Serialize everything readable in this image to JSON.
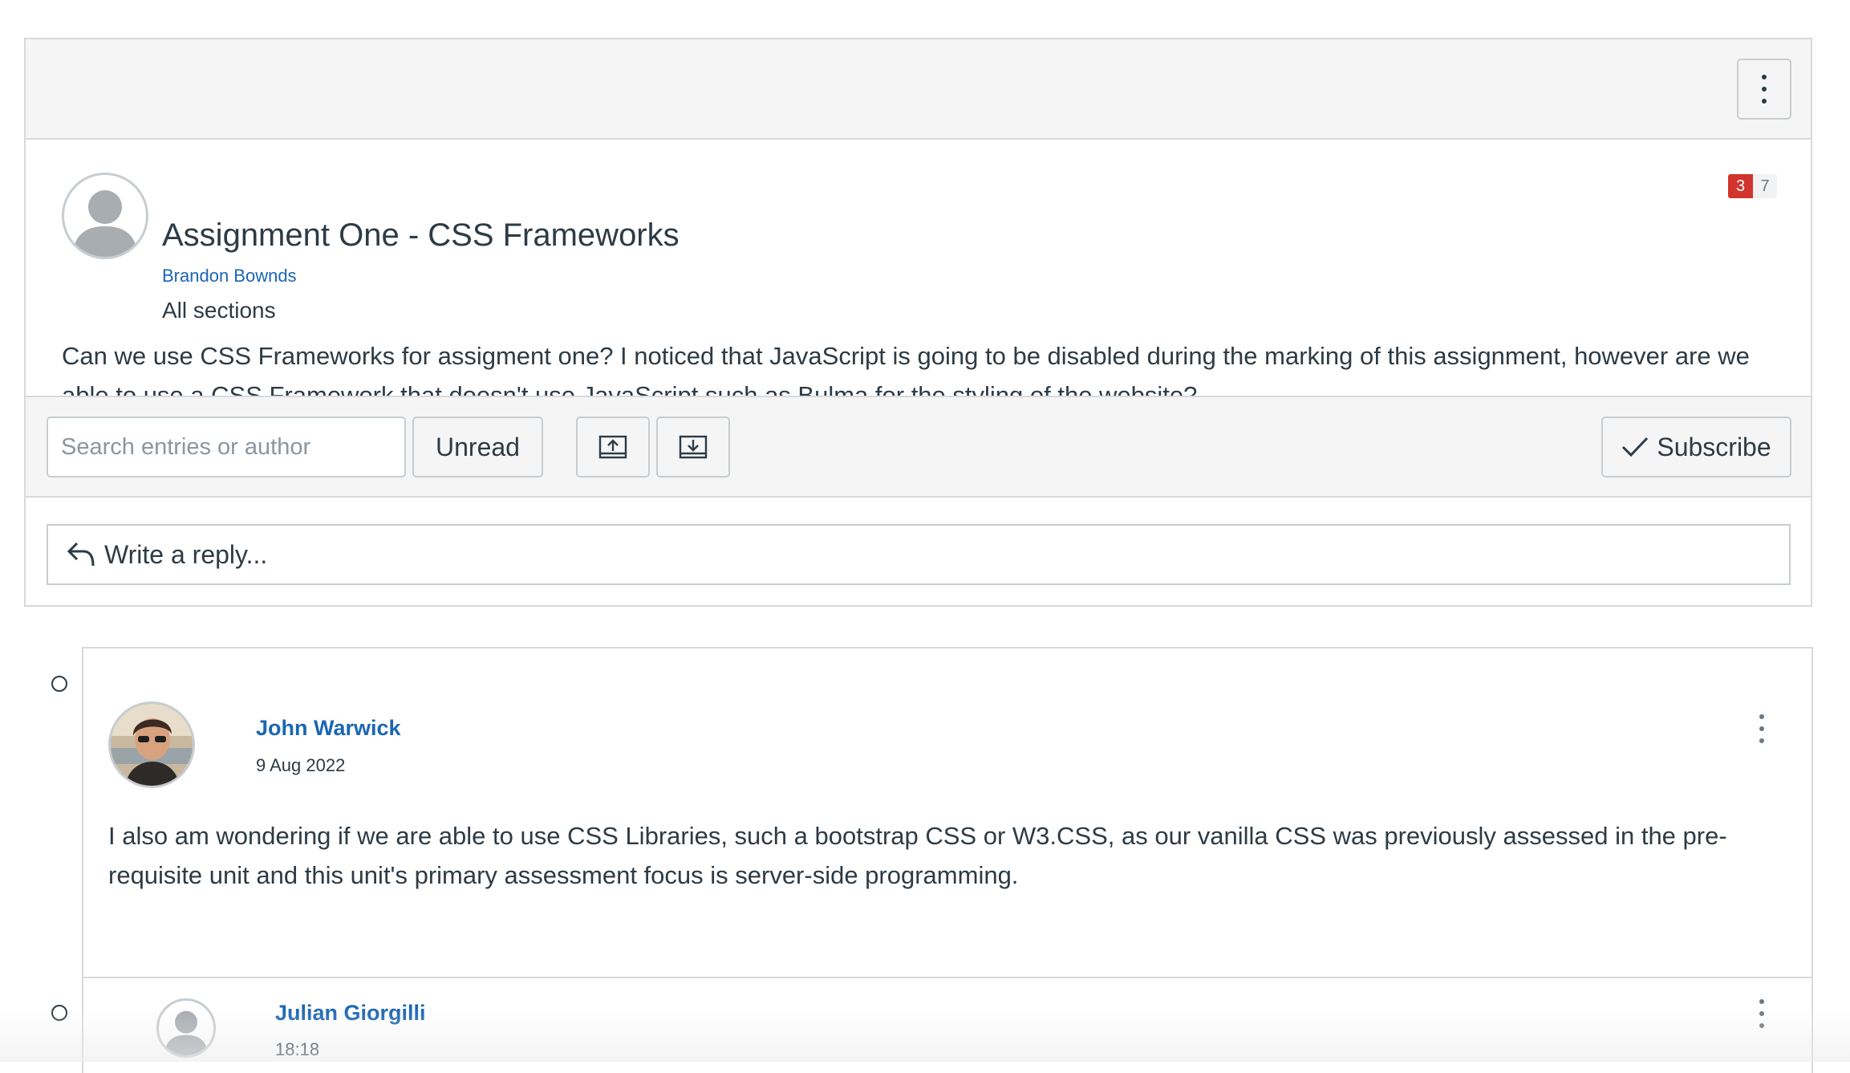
{
  "topic": {
    "title": "Assignment One - CSS Frameworks",
    "author": "Brandon Bownds",
    "sections": "All sections",
    "body": "Can we use CSS Frameworks for assigment one? I noticed that JavaScript is going to be disabled during the marking of this assignment, however are we able to use a CSS Framework that doesn't use JavaScript such as Bulma for the styling of the website?",
    "unread_count": "3",
    "total_count": "7",
    "menu_icon": "kebab-vertical-icon"
  },
  "toolbar": {
    "search_placeholder": "Search entries or author",
    "unread_label": "Unread",
    "collapse_icon": "collapse-threads-icon",
    "expand_icon": "expand-threads-icon",
    "subscribe_label": "Subscribe",
    "subscribe_icon": "check-icon"
  },
  "reply_box": {
    "label": "Write a reply...",
    "icon": "reply-arrow-icon"
  },
  "replies": [
    {
      "author": "John Warwick",
      "date": "9 Aug 2022",
      "body": "I also am wondering if we are able to use CSS Libraries, such a bootstrap CSS or W3.CSS, as our vanilla CSS was previously assessed in the pre-requisite unit and this unit's primary assessment focus is server-side programming."
    },
    {
      "author": "Julian Giorgilli",
      "date": "18:18"
    }
  ],
  "colors": {
    "link": "#1b66b3",
    "badge_unread": "#d0342c",
    "text": "#2d3b45",
    "border": "#c7cdd1",
    "header_bg": "#f5f5f5"
  }
}
